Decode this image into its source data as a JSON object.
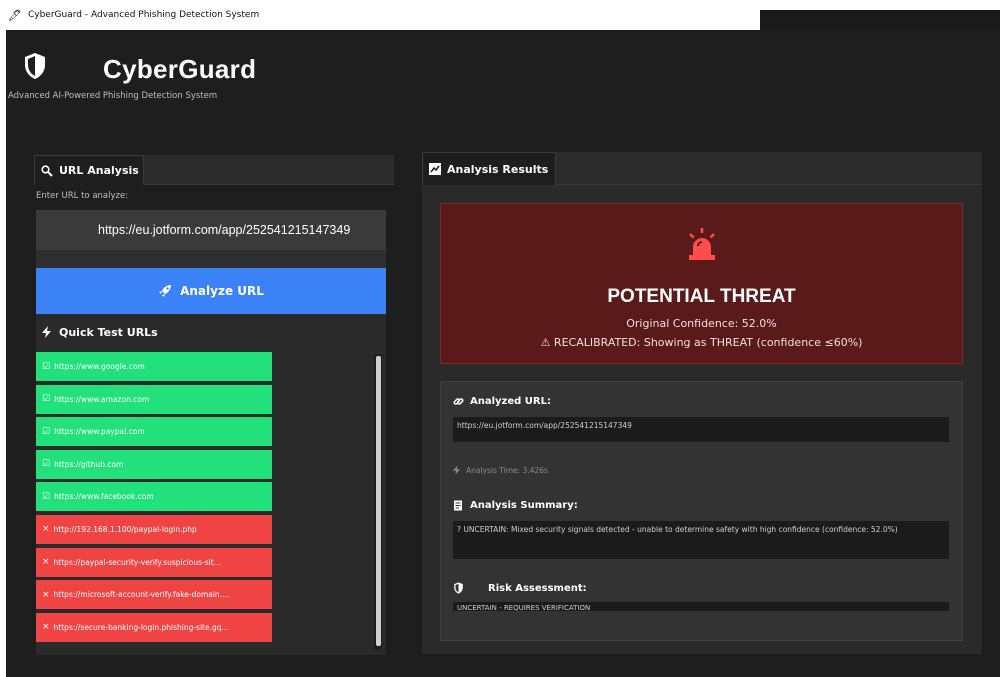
{
  "window": {
    "title": "CyberGuard - Advanced Phishing Detection System"
  },
  "header": {
    "brand": "CyberGuard",
    "tagline": "Advanced AI-Powered Phishing Detection System"
  },
  "url_analysis": {
    "tab_label": "URL Analysis",
    "field_label": "Enter URL to analyze:",
    "url_value": "https://eu.jotform.com/app/252541215147349",
    "analyze_label": "Analyze URL"
  },
  "quick_tests": {
    "heading": "Quick Test URLs",
    "items": [
      {
        "mark": "☑",
        "label": "https://www.google.com",
        "status": "safe"
      },
      {
        "mark": "☑",
        "label": "https://www.amazon.com",
        "status": "safe"
      },
      {
        "mark": "☑",
        "label": "https://www.paypal.com",
        "status": "safe"
      },
      {
        "mark": "☑",
        "label": "https://github.com",
        "status": "safe"
      },
      {
        "mark": "☑",
        "label": "https://www.facebook.com",
        "status": "safe"
      },
      {
        "mark": "×",
        "label": "http://192.168.1.100/paypal-login.php",
        "status": "phishing"
      },
      {
        "mark": "×",
        "label": "https://paypal-security-verify.suspicious-sit...",
        "status": "phishing"
      },
      {
        "mark": "×",
        "label": "https://microsoft-account-verify.fake-domain....",
        "status": "phishing"
      },
      {
        "mark": "×",
        "label": "https://secure-banking-login.phishing-site.gq...",
        "status": "phishing"
      }
    ]
  },
  "results": {
    "tab_label": "Analysis Results",
    "verdict": "POTENTIAL THREAT",
    "confidence_text": "Original Confidence: 52.0%",
    "recalibrated_text": "⚠ RECALIBRATED: Showing as THREAT (confidence ≤60%)",
    "analyzed_url_label": "Analyzed URL:",
    "analyzed_url": "https://eu.jotform.com/app/252541215147349",
    "analysis_time": "Analysis Time: 3.426s",
    "summary_label": "Analysis Summary:",
    "summary_text": "? UNCERTAIN: Mixed security signals detected - unable to determine safety with high confidence (confidence: 52.0%)",
    "risk_label": "Risk Assessment:",
    "risk_text": "UNCERTAIN - REQUIRES VERIFICATION"
  },
  "colors": {
    "background": "#1e1e1e",
    "accent_blue": "#3b82f6",
    "safe_green": "#22e07a",
    "danger_red": "#f04444",
    "threat_panel": "#5a1a1a",
    "alarm_red": "#ff4d4d"
  },
  "icons": {
    "app": "feather-icon",
    "brand": "shield-icon",
    "url_tab": "magnifier-icon",
    "analyze": "rocket-icon",
    "quick": "lightning-icon",
    "results": "chart-icon",
    "alarm": "siren-icon",
    "link": "link-icon",
    "summary": "document-icon",
    "risk": "shield-icon"
  }
}
